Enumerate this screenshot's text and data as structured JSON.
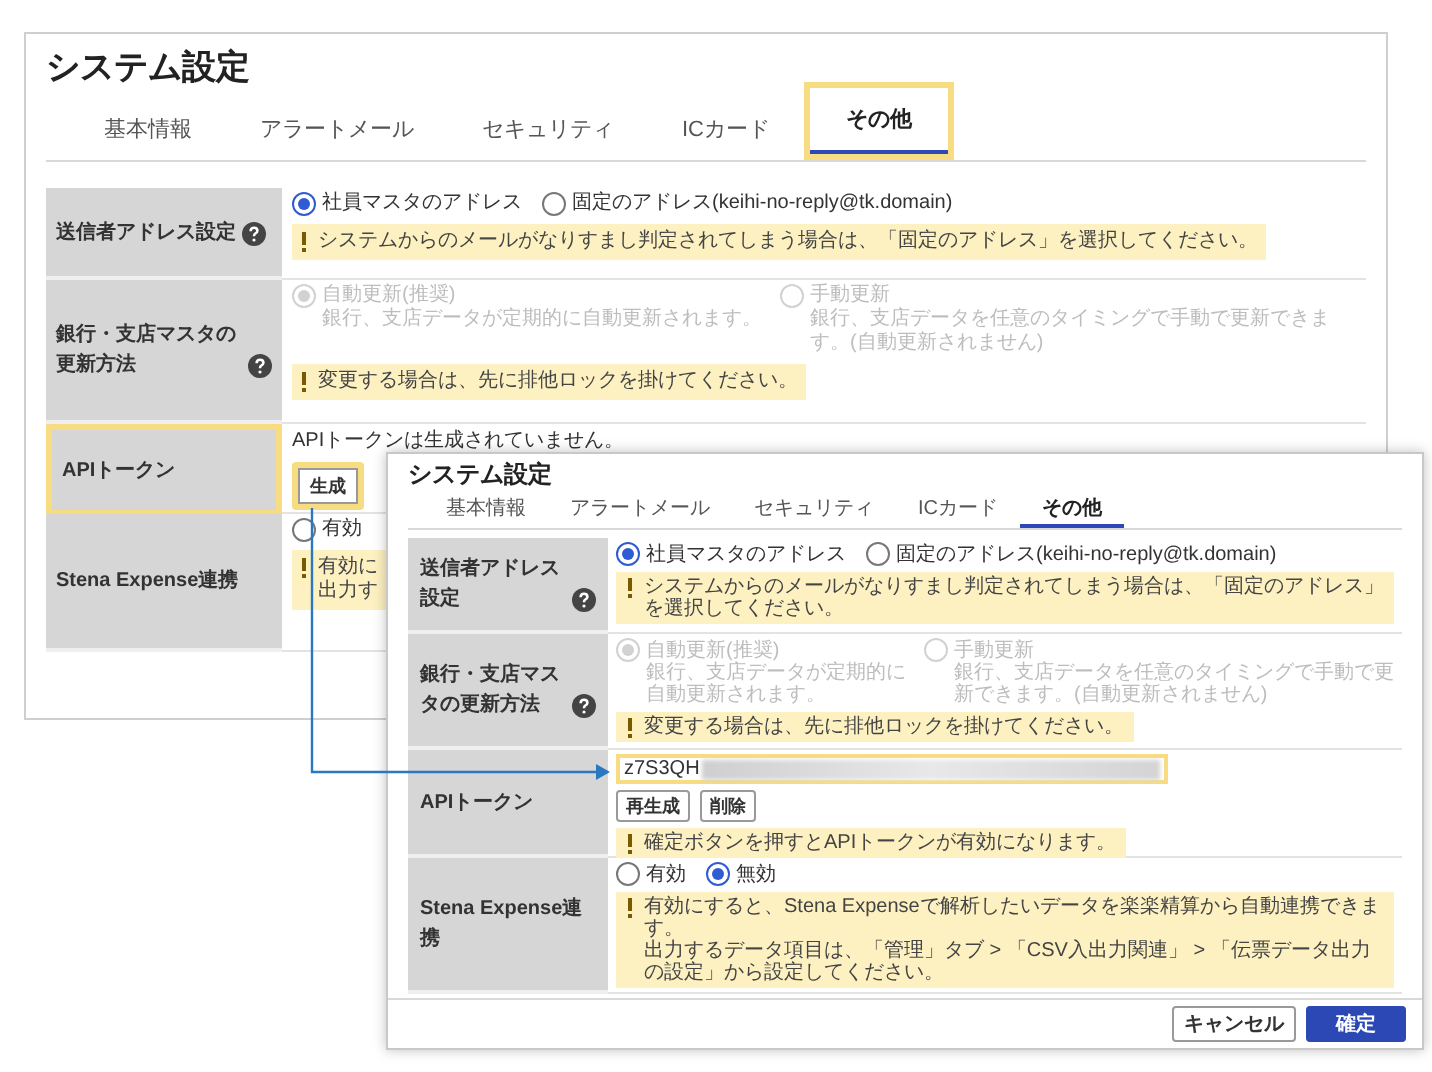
{
  "back_window": {
    "title": "システム設定",
    "tabs": [
      {
        "label": "基本情報",
        "selected": false,
        "highlighted": false
      },
      {
        "label": "アラートメール",
        "selected": false,
        "highlighted": false
      },
      {
        "label": "セキュリティ",
        "selected": false,
        "highlighted": false
      },
      {
        "label": "ICカード",
        "selected": false,
        "highlighted": false
      },
      {
        "label": "その他",
        "selected": true,
        "highlighted": true
      }
    ],
    "rows": [
      {
        "kind": "radio",
        "label": "送信者アドレス設定",
        "help": true,
        "label_highlighted": false,
        "options": [
          {
            "label": "社員マスタのアドレス",
            "selected": true
          },
          {
            "label": "固定のアドレス(keihi-no-reply@tk.domain)",
            "selected": false
          }
        ],
        "notes": [
          {
            "lines": [
              "システムからのメールがなりすまし判定されてしまう場合は、「固定のアドレス」を選択してください。"
            ]
          }
        ]
      },
      {
        "kind": "radio_detail",
        "label": "銀行・支店マスタの更新方法",
        "help": true,
        "label_highlighted": false,
        "disabled": true,
        "options": [
          {
            "label": "自動更新(推奨)",
            "description": "銀行、支店データが定期的に自動更新されます。",
            "selected": true
          },
          {
            "label": "手動更新",
            "description": "銀行、支店データを任意のタイミングで手動で更新できます。(自動更新されません)",
            "selected": false
          }
        ],
        "notes": [
          {
            "lines": [
              "変更する場合は、先に排他ロックを掛けてください。"
            ]
          }
        ]
      },
      {
        "kind": "token",
        "label": "APIトークン",
        "help": false,
        "label_highlighted": true,
        "status": "APIトークンは生成されていません。",
        "buttons": [
          {
            "label": "生成",
            "highlighted": true
          }
        ]
      },
      {
        "kind": "radio",
        "label": "Stena Expense連携",
        "help": false,
        "label_highlighted": false,
        "options": [
          {
            "label": "有効",
            "selected": false
          }
        ],
        "notes": [
          {
            "lines": [
              "有効に",
              "出力す"
            ]
          }
        ]
      }
    ]
  },
  "front_window": {
    "title": "システム設定",
    "tabs": [
      {
        "label": "基本情報",
        "selected": false,
        "highlighted": false
      },
      {
        "label": "アラートメール",
        "selected": false,
        "highlighted": false
      },
      {
        "label": "セキュリティ",
        "selected": false,
        "highlighted": false
      },
      {
        "label": "ICカード",
        "selected": false,
        "highlighted": false
      },
      {
        "label": "その他",
        "selected": true,
        "highlighted": false
      }
    ],
    "rows": [
      {
        "kind": "radio",
        "label": "送信者アドレス設定",
        "help": true,
        "label_highlighted": false,
        "options": [
          {
            "label": "社員マスタのアドレス",
            "selected": true
          },
          {
            "label": "固定のアドレス(keihi-no-reply@tk.domain)",
            "selected": false
          }
        ],
        "notes": [
          {
            "lines": [
              "システムからのメールがなりすまし判定されてしまう場合は、「固定のアドレス」を選択してください。"
            ]
          }
        ]
      },
      {
        "kind": "radio_detail",
        "label": "銀行・支店マスタの更新方法",
        "help": true,
        "label_highlighted": false,
        "disabled": true,
        "options": [
          {
            "label": "自動更新(推奨)",
            "description": "銀行、支店データが定期的に自動更新されます。",
            "selected": true
          },
          {
            "label": "手動更新",
            "description": "銀行、支店データを任意のタイミングで手動で更新できます。(自動更新されません)",
            "selected": false
          }
        ],
        "notes": [
          {
            "lines": [
              "変更する場合は、先に排他ロックを掛けてください。"
            ]
          }
        ]
      },
      {
        "kind": "token",
        "label": "APIトークン",
        "help": false,
        "label_highlighted": false,
        "token": "z7S3QH",
        "token_highlighted": true,
        "masked": true,
        "buttons": [
          {
            "label": "再生成",
            "highlighted": false
          },
          {
            "label": "削除",
            "highlighted": false
          }
        ],
        "notes": [
          {
            "lines": [
              "確定ボタンを押すとAPIトークンが有効になります。"
            ]
          }
        ]
      },
      {
        "kind": "radio",
        "label": "Stena Expense連携",
        "help": false,
        "label_highlighted": false,
        "options": [
          {
            "label": "有効",
            "selected": false
          },
          {
            "label": "無効",
            "selected": true
          }
        ],
        "notes": [
          {
            "lines": [
              "有効にすると、Stena Expenseで解析したいデータを楽楽精算から自動連携できます。",
              "出力するデータ項目は、「管理」タブ > 「CSV入出力関連」 > 「伝票データ出力の設定」から設定してください。"
            ]
          }
        ]
      }
    ],
    "footer_buttons": [
      {
        "label": "キャンセル",
        "primary": false
      },
      {
        "label": "確定",
        "primary": true
      }
    ]
  }
}
